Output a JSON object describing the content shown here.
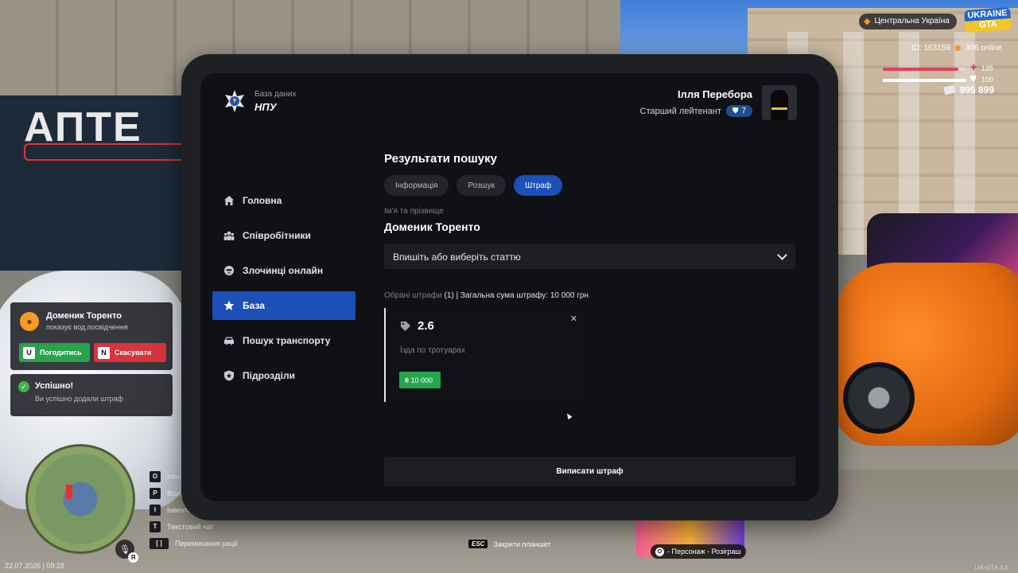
{
  "hud": {
    "region": "Центральна Україна",
    "logo_line1": "UKRAINE",
    "logo_line2": "GTA",
    "player_id": "ID: 163159",
    "online": "306 online",
    "health": "135",
    "health_fraction": 0.9,
    "armor": "100",
    "armor_fraction": 1.0,
    "money": "995 899",
    "colors": {
      "health": "#e0405a",
      "armor": "#ffffff",
      "accent": "#f59a25"
    }
  },
  "notifications": {
    "request": {
      "name": "Доменик Торенто",
      "text": "показує вод.посвідчення",
      "accept_key": "U",
      "accept_label": "Погодитись",
      "cancel_key": "N",
      "cancel_label": "Скасувати"
    },
    "success": {
      "title": "Успішно!",
      "text": "Ви успішно додали штраф"
    }
  },
  "hotkeys": [
    {
      "key": "O",
      "label": "Меню"
    },
    {
      "key": "P",
      "label": "Відкрити телефон"
    },
    {
      "key": "I",
      "label": "Інвентар"
    },
    {
      "key": "T",
      "label": "Текстовий чат"
    },
    {
      "key": "[ ]",
      "label": "Перемикання рації"
    }
  ],
  "voice_key": "Я",
  "datetime": "22.07.2026 | 09:28",
  "esc_hint": {
    "key": "ESC",
    "label": "Закрити планшет"
  },
  "promo": {
    "key": "O",
    "label": "- Персонаж - Розіграш"
  },
  "version": "UA-GTA 4.II",
  "tablet": {
    "brand": {
      "sub": "База даних",
      "main": "НПУ"
    },
    "user": {
      "name": "Ілля Перебора",
      "rank": "Старший лейтенант",
      "level": "7"
    },
    "nav": [
      {
        "label": "Головна",
        "icon": "home-icon"
      },
      {
        "label": "Співробітники",
        "icon": "people-icon"
      },
      {
        "label": "Злочинці онлайн",
        "icon": "criminal-icon"
      },
      {
        "label": "База",
        "icon": "star-icon",
        "active": true
      },
      {
        "label": "Пошук транспорту",
        "icon": "car-icon"
      },
      {
        "label": "Підрозділи",
        "icon": "shield-icon"
      }
    ],
    "results": {
      "title": "Результати пошуку",
      "tabs": [
        {
          "label": "Інформація"
        },
        {
          "label": "Розшук"
        },
        {
          "label": "Штраф",
          "active": true
        }
      ],
      "name_label": "Ім'я та прізвище",
      "name_value": "Доменик Торенто",
      "select_placeholder": "Впишіть або виберіть статтю",
      "summary_prefix": "Обрані штрафи",
      "summary_rest": "(1) | Загальна сума штрафу: 10 000 грн",
      "fine": {
        "code": "2.6",
        "description": "Їзда по тротуарах",
        "amount": "₴ 10 000"
      },
      "submit_label": "Виписати штраф"
    }
  }
}
